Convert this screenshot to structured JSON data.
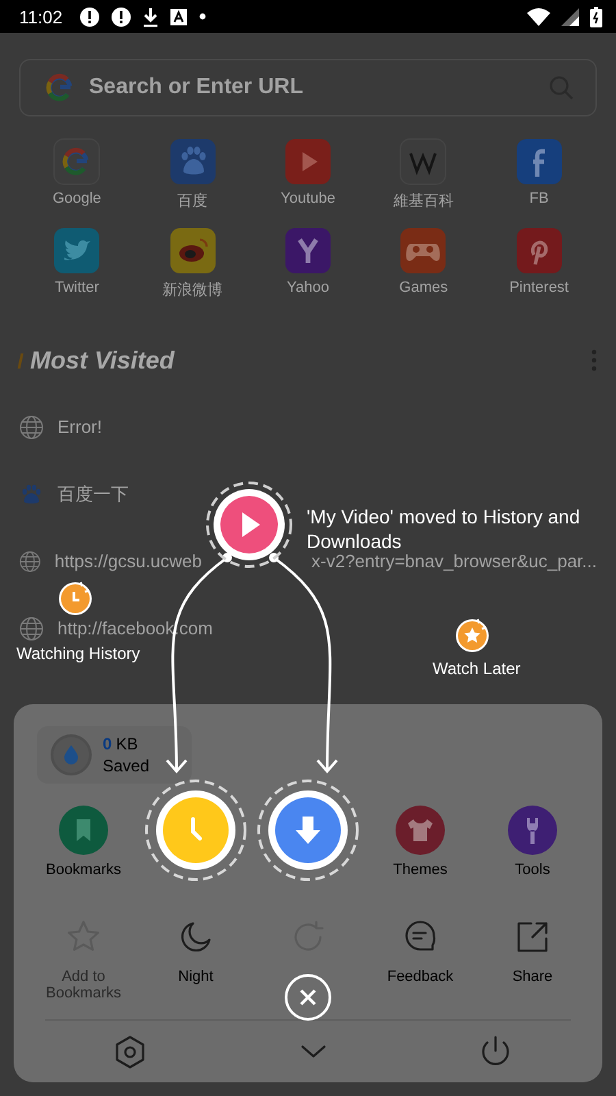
{
  "status_bar": {
    "time": "11:02"
  },
  "search": {
    "placeholder": "Search or Enter URL"
  },
  "shortcuts": [
    {
      "label": "Google"
    },
    {
      "label": "百度"
    },
    {
      "label": "Youtube"
    },
    {
      "label": "維基百科"
    },
    {
      "label": "FB"
    },
    {
      "label": "Twitter"
    },
    {
      "label": "新浪微博"
    },
    {
      "label": "Yahoo"
    },
    {
      "label": "Games"
    },
    {
      "label": "Pinterest"
    }
  ],
  "most_visited": {
    "title": "Most Visited",
    "items": [
      {
        "parts": [
          "Error!"
        ]
      },
      {
        "parts": [
          "百度一下"
        ]
      },
      {
        "parts": [
          "https://gcsu.ucweb",
          "x-v2?entry=bnav_browser&uc_par..."
        ]
      },
      {
        "parts": [
          "http://facebook.com"
        ]
      }
    ]
  },
  "menu": {
    "saved": {
      "amount": "0",
      "unit": "KB",
      "label": "Saved"
    },
    "items": [
      {
        "label": "Bookmarks",
        "highlighted": false,
        "disabled": false
      },
      {
        "highlighted": true,
        "disabled": false
      },
      {
        "highlighted": true,
        "disabled": false
      },
      {
        "label": "Themes",
        "highlighted": false,
        "disabled": false
      },
      {
        "label": "Tools",
        "highlighted": false,
        "disabled": false
      },
      {
        "label": "Add to Bookmarks",
        "highlighted": false,
        "disabled": true
      },
      {
        "label": "Night",
        "highlighted": false,
        "disabled": false
      },
      {
        "highlighted": false,
        "disabled": true
      },
      {
        "label": "Feedback",
        "highlighted": false,
        "disabled": false
      },
      {
        "label": "Share",
        "highlighted": false,
        "disabled": false
      }
    ]
  },
  "tutorial": {
    "message": "'My Video' moved to History and Downloads",
    "markers": [
      {
        "label": "Watching History"
      },
      {
        "label": "Watch Later"
      }
    ]
  }
}
